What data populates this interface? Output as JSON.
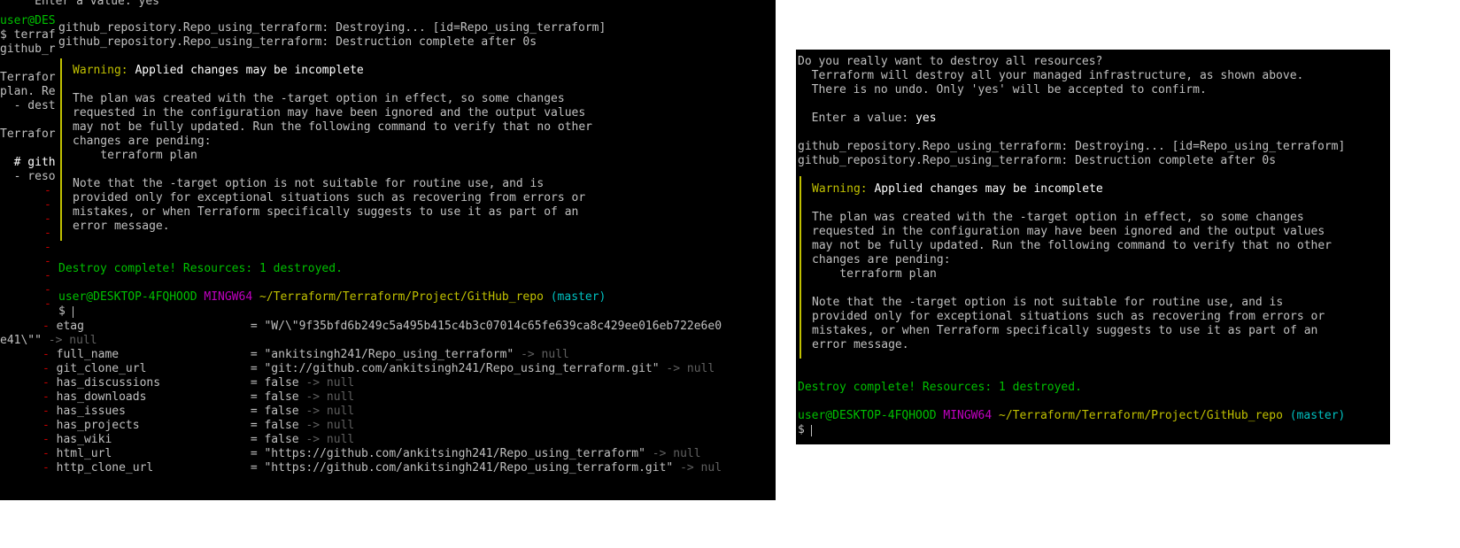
{
  "bg_lines": [
    {
      "text": "     Enter a value: yes",
      "cls": ""
    },
    {
      "text": "user@DES",
      "cls": "g"
    },
    {
      "text": "$ terraf",
      "cls": ""
    },
    {
      "text": "github_r",
      "cls": ""
    },
    {
      "text": "Terrafor",
      "cls": ""
    },
    {
      "text": "plan. Re",
      "cls": ""
    },
    {
      "text": "  - dest",
      "cls": ""
    },
    {
      "text": "Terrafor",
      "cls": ""
    },
    {
      "text": "  # gith",
      "cls": "w"
    },
    {
      "text": "  - reso",
      "cls": ""
    }
  ],
  "resource_rows": [
    {
      "key": "etag",
      "value": "\"W/\\\"9f35bfd6b249c5a495b415c4b3c07014c65fe639ca8c429ee016eb722e6e0",
      "null": ""
    },
    {
      "key": "",
      "value": "e41\\\"\"",
      "null": "-> null",
      "wrap": true
    },
    {
      "key": "full_name",
      "value": "\"ankitsingh241/Repo_using_terraform\"",
      "null": "-> null"
    },
    {
      "key": "git_clone_url",
      "value": "\"git://github.com/ankitsingh241/Repo_using_terraform.git\"",
      "null": "-> null"
    },
    {
      "key": "has_discussions",
      "value": "false",
      "null": "-> null"
    },
    {
      "key": "has_downloads",
      "value": "false",
      "null": "-> null"
    },
    {
      "key": "has_issues",
      "value": "false",
      "null": "-> null"
    },
    {
      "key": "has_projects",
      "value": "false",
      "null": "-> null"
    },
    {
      "key": "has_wiki",
      "value": "false",
      "null": "-> null"
    },
    {
      "key": "html_url",
      "value": "\"https://github.com/ankitsingh241/Repo_using_terraform\"",
      "null": "-> null"
    },
    {
      "key": "http_clone_url",
      "value": "\"https://github.com/ankitsingh241/Repo_using_terraform.git\"",
      "null": "-> nul"
    }
  ],
  "output": {
    "confirm_q": "Do you really want to destroy all resources?",
    "confirm_1": "  Terraform will destroy all your managed infrastructure, as shown above.",
    "confirm_2": "  There is no undo. Only 'yes' will be accepted to confirm.",
    "enter_label": "  Enter a value: ",
    "enter_value": "yes",
    "destroying": "github_repository.Repo_using_terraform: Destroying... [id=Repo_using_terraform]",
    "destroyed": "github_repository.Repo_using_terraform: Destruction complete after 0s",
    "warning_label": "Warning:",
    "warning_title": " Applied changes may be incomplete",
    "plan_1": "The plan was created with the -target option in effect, so some changes",
    "plan_2": "requested in the configuration may have been ignored and the output values",
    "plan_3": "may not be fully updated. Run the following command to verify that no other",
    "plan_4": "changes are pending:",
    "plan_cmd": "    terraform plan",
    "note_1": "Note that the -target option is not suitable for routine use, and is",
    "note_2": "provided only for exceptional situations such as recovering from errors or",
    "note_3": "mistakes, or when Terraform specifically suggests to use it as part of an",
    "note_4": "error message.",
    "complete": "Destroy complete! Resources: 1 destroyed.",
    "prompt_user": "user@DESKTOP-4FQHOOD",
    "prompt_shell": " MINGW64",
    "prompt_path": " ~/Terraform/Terraform/Project/GitHub_repo",
    "prompt_branch": " (master)",
    "prompt_dollar": "$ "
  }
}
